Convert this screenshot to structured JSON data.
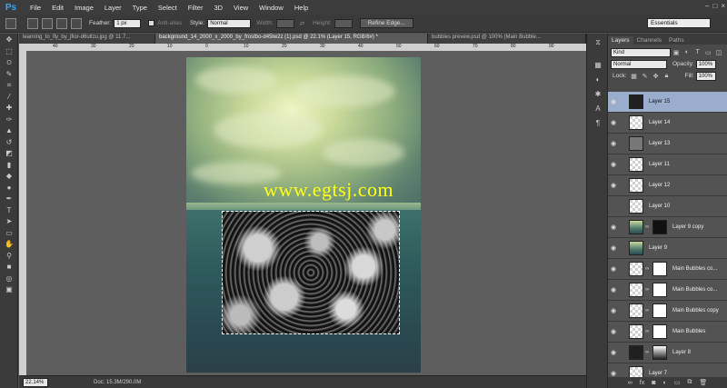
{
  "app": {
    "logo": "Ps"
  },
  "menu": [
    "File",
    "Edit",
    "Image",
    "Layer",
    "Type",
    "Select",
    "Filter",
    "3D",
    "View",
    "Window",
    "Help"
  ],
  "window_controls": [
    "–",
    "□",
    "×"
  ],
  "options": {
    "feather_label": "Feather:",
    "feather_value": "1 px",
    "antialias_label": "Anti-alias",
    "style_label": "Style:",
    "style_value": "Normal",
    "width_label": "Width:",
    "height_label": "Height:",
    "refine_edge": "Refine Edge...",
    "workspace": "Essentials"
  },
  "tabs": [
    {
      "label": "learning_to_fly_by_jfior-d6ultzu.jpg @ 11.7...",
      "active": false
    },
    {
      "label": "background_14_2000_x_2000_by_frostbo-d45lw2z (1).psd @ 22.1% (Layer 15, RGB/8#) *",
      "active": true
    },
    {
      "label": "bubbles prevew.psd @ 100% (Main Bubble...",
      "active": false
    }
  ],
  "ruler_numbers": [
    "40",
    "30",
    "20",
    "10",
    "0",
    "10",
    "20",
    "30",
    "40",
    "50",
    "60",
    "70",
    "80",
    "90",
    "100"
  ],
  "watermark": "www.egtsj.com",
  "status": {
    "zoom": "22.14%",
    "doc": "Doc: 15.3M/290.0M"
  },
  "panel": {
    "tabs": [
      "Layers",
      "Channels",
      "Paths"
    ],
    "kind": "Kind",
    "blend_mode": "Normal",
    "opacity_label": "Opacity:",
    "opacity_value": "100%",
    "lock_label": "Lock:",
    "fill_label": "Fill:",
    "fill_value": "100%"
  },
  "layers": [
    {
      "name": "Layer 15",
      "visible": true,
      "selected": true,
      "thumb": "dark",
      "mask": null
    },
    {
      "name": "Layer 14",
      "visible": true,
      "selected": false,
      "thumb": "transparent",
      "mask": null
    },
    {
      "name": "Layer 13",
      "visible": true,
      "selected": false,
      "thumb": "gray",
      "mask": null
    },
    {
      "name": "Layer 11",
      "visible": true,
      "selected": false,
      "thumb": "transparent",
      "mask": null
    },
    {
      "name": "Layer 12",
      "visible": true,
      "selected": false,
      "thumb": "transparent",
      "mask": null
    },
    {
      "name": "Layer 10",
      "visible": false,
      "selected": false,
      "thumb": "transparent",
      "mask": null
    },
    {
      "name": "Layer 9 copy",
      "visible": true,
      "selected": false,
      "thumb": "scene",
      "mask": "black"
    },
    {
      "name": "Layer 9",
      "visible": true,
      "selected": false,
      "thumb": "scene",
      "mask": null
    },
    {
      "name": "Main Bubbles co...",
      "visible": true,
      "selected": false,
      "thumb": "transparent",
      "mask": "white"
    },
    {
      "name": "Main Bubbles co...",
      "visible": true,
      "selected": false,
      "thumb": "transparent",
      "mask": "white"
    },
    {
      "name": "Main Bubbles copy",
      "visible": true,
      "selected": false,
      "thumb": "transparent",
      "mask": "white"
    },
    {
      "name": "Main Bubbles",
      "visible": true,
      "selected": false,
      "thumb": "transparent",
      "mask": "white"
    },
    {
      "name": "Layer 8",
      "visible": true,
      "selected": false,
      "thumb": "dark",
      "mask": "grad"
    },
    {
      "name": "Layer 7",
      "visible": true,
      "selected": false,
      "thumb": "transparent",
      "mask": null
    }
  ],
  "footer_icons": [
    "link-icon",
    "fx-icon",
    "mask-icon",
    "adjustment-icon",
    "folder-icon",
    "new-layer-icon",
    "trash-icon"
  ]
}
